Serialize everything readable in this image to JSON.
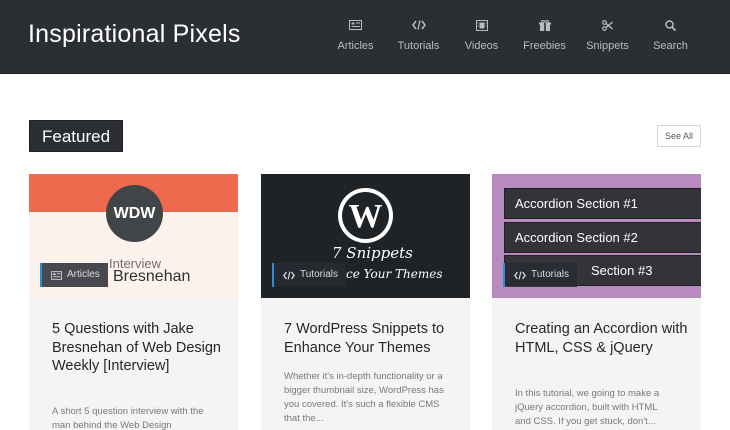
{
  "header": {
    "brand": "Inspirational Pixels",
    "nav": [
      {
        "label": "Articles",
        "icon": "articles-icon"
      },
      {
        "label": "Tutorials",
        "icon": "code-icon"
      },
      {
        "label": "Videos",
        "icon": "film-icon"
      },
      {
        "label": "Freebies",
        "icon": "gift-icon"
      },
      {
        "label": "Snippets",
        "icon": "scissors-icon"
      },
      {
        "label": "Search",
        "icon": "search-icon"
      }
    ]
  },
  "section": {
    "title": "Featured",
    "see_all": "See All"
  },
  "cards": [
    {
      "thumb": {
        "monogram": "WDW",
        "line1": "Interview",
        "line2": "Bresnehan"
      },
      "category": "Articles",
      "title": "5 Questions with Jake Bresnehan of Web Design Weekly [Interview]",
      "excerpt": "A short 5 question interview with the man behind the Web Design"
    },
    {
      "thumb": {
        "logo": "W",
        "line1": "7 Snippets",
        "line2": "ce Your Themes"
      },
      "category": "Tutorials",
      "title": "7 WordPress Snippets to Enhance Your Themes",
      "excerpt": "Whether it's in-depth functionality or a bigger thumbnail size, WordPress has you covered. It's such a flexible CMS that the..."
    },
    {
      "thumb": {
        "sections": [
          "Accordion Section #1",
          "Accordion Section #2",
          "Section #3"
        ]
      },
      "category": "Tutorials",
      "title": "Creating an Accordion with HTML, CSS & jQuery",
      "excerpt": "In this tutorial, we going to make a jQuery accordion, built with HTML and CSS. If you get stuck, don't..."
    }
  ],
  "colors": {
    "header_bg": "#2b2e33",
    "accent": "#2c8fd1",
    "card_bg": "#f4f4f4",
    "wdw_orange": "#ed6a4e",
    "accordion_purple": "#b98ac0"
  }
}
